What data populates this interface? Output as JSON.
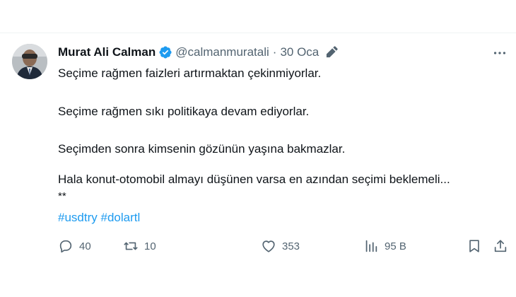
{
  "author": {
    "name": "Murat Ali Calman",
    "handle": "@calmanmuratali",
    "separator": "·",
    "date": "30 Oca"
  },
  "tweet": {
    "lines": [
      "Seçime rağmen faizleri artırmaktan çekinmiyorlar.",
      "Seçime rağmen sıkı politikaya devam ediyorlar.",
      "Seçimden sonra kimsenin gözünün yaşına bakmazlar.",
      "Hala konut-otomobil almayı düşünen varsa en azından seçimi beklemeli...",
      "**"
    ],
    "hashtags": [
      "#usdtry",
      "#dolartl"
    ]
  },
  "actions": {
    "replies": "40",
    "retweets": "10",
    "likes": "353",
    "views": "95 B"
  },
  "icons": {
    "verified": "verified-badge-icon",
    "edit": "edit-pencil-icon",
    "more": "more-horizontal-icon",
    "reply": "reply-icon",
    "retweet": "retweet-icon",
    "like": "heart-icon",
    "views": "views-bar-icon",
    "bookmark": "bookmark-icon",
    "share": "share-icon"
  },
  "colors": {
    "accent": "#1d9bf0",
    "text": "#0f1419",
    "secondary": "#536471"
  }
}
